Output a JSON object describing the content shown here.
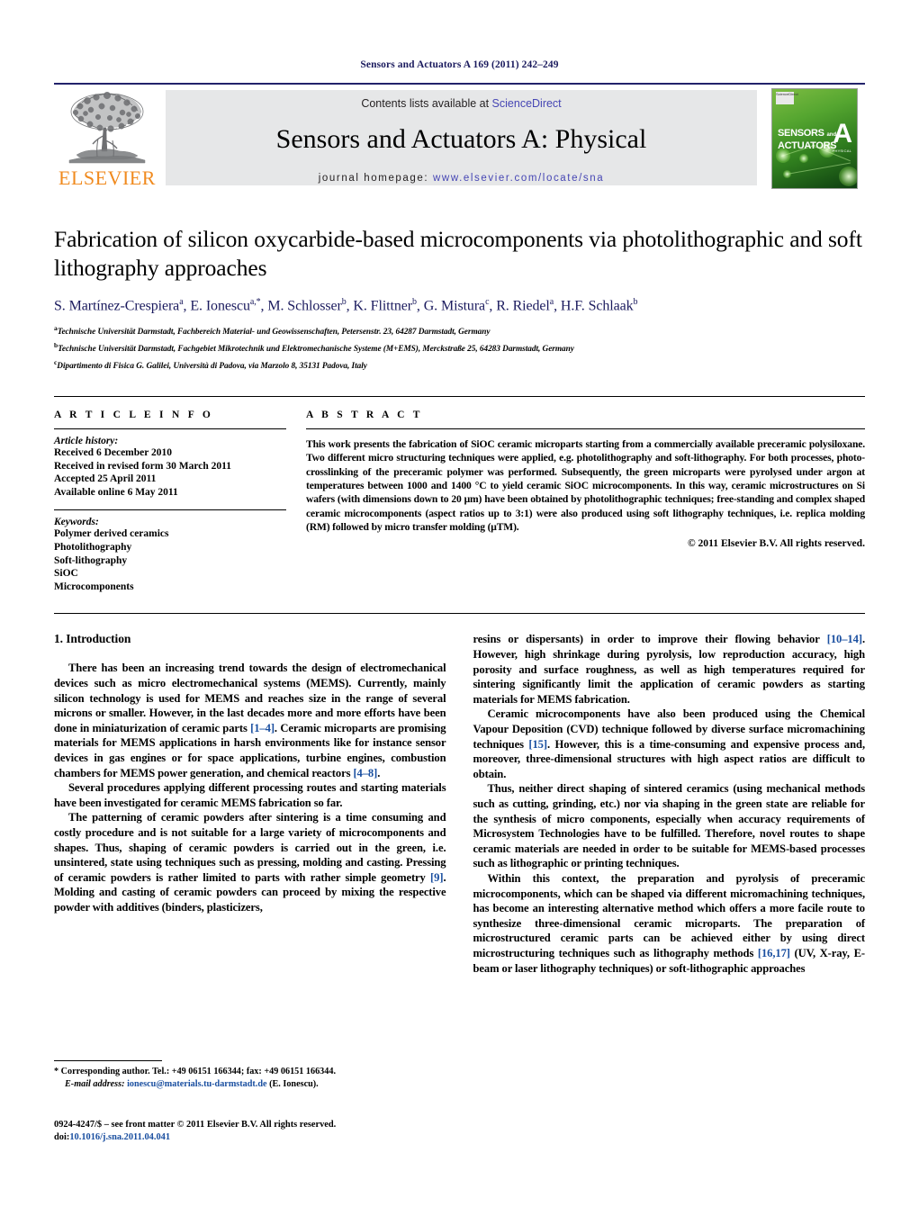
{
  "running_head": "Sensors and Actuators A 169 (2011) 242–249",
  "masthead": {
    "publisher_word": "ELSEVIER",
    "contents_prefix": "Contents lists available at ",
    "contents_link": "ScienceDirect",
    "journal_title": "Sensors and Actuators A: Physical",
    "homepage_label": "journal homepage:",
    "homepage_url": "www.elsevier.com/locate/sna",
    "cover": {
      "line1": "SENSORS",
      "and": "and",
      "line2": "ACTUATORS",
      "letter": "A",
      "sub": "PHYSICAL",
      "badge": "ScienceDirect"
    }
  },
  "article": {
    "title": "Fabrication of silicon oxycarbide-based microcomponents via photolithographic and soft lithography approaches",
    "authors": "S. Martínez-Crespiera a, E. Ionescu a,*, M. Schlosser b, K. Flittner b, G. Mistura c, R. Riedel a, H.F. Schlaak b",
    "author_list": [
      {
        "name": "S. Martínez-Crespiera",
        "sup": "a"
      },
      {
        "name": "E. Ionescu",
        "sup": "a,*"
      },
      {
        "name": "M. Schlosser",
        "sup": "b"
      },
      {
        "name": "K. Flittner",
        "sup": "b"
      },
      {
        "name": "G. Mistura",
        "sup": "c"
      },
      {
        "name": "R. Riedel",
        "sup": "a"
      },
      {
        "name": "H.F. Schlaak",
        "sup": "b"
      }
    ],
    "affiliations": [
      {
        "sup": "a",
        "text": "Technische Universität Darmstadt, Fachbereich Material- und Geowissenschaften, Petersenstr. 23, 64287 Darmstadt, Germany"
      },
      {
        "sup": "b",
        "text": "Technische Universität Darmstadt, Fachgebiet Mikrotechnik und Elektromechanische Systeme (M+EMS), Merckstraße 25, 64283 Darmstadt, Germany"
      },
      {
        "sup": "c",
        "text": "Dipartimento di Fisica G. Galilei, Università di Padova, via Marzolo 8, 35131 Padova, Italy"
      }
    ]
  },
  "article_info": {
    "heading": "A R T I C L E   I N F O",
    "history_label": "Article history:",
    "history": [
      "Received 6 December 2010",
      "Received in revised form 30 March 2011",
      "Accepted 25 April 2011",
      "Available online 6 May 2011"
    ],
    "keywords_label": "Keywords:",
    "keywords": [
      "Polymer derived ceramics",
      "Photolithography",
      "Soft-lithography",
      "SiOC",
      "Microcomponents"
    ]
  },
  "abstract": {
    "heading": "A B S T R A C T",
    "text": "This work presents the fabrication of SiOC ceramic microparts starting from a commercially available preceramic polysiloxane. Two different micro structuring techniques were applied, e.g. photolithography and soft-lithography. For both processes, photo-crosslinking of the preceramic polymer was performed. Subsequently, the green microparts were pyrolysed under argon at temperatures between 1000 and 1400 °C to yield ceramic SiOC microcomponents. In this way, ceramic microstructures on Si wafers (with dimensions down to 20 μm) have been obtained by photolithographic techniques; free-standing and complex shaped ceramic microcomponents (aspect ratios up to 3:1) were also produced using soft lithography techniques, i.e. replica molding (RM) followed by micro transfer molding (μTM).",
    "copyright": "© 2011 Elsevier B.V. All rights reserved."
  },
  "introduction": {
    "heading": "1. Introduction",
    "left_paragraphs": [
      "There has been an increasing trend towards the design of electromechanical devices such as micro electromechanical systems (MEMS). Currently, mainly silicon technology is used for MEMS and reaches size in the range of several microns or smaller. However, in the last decades more and more efforts have been done in miniaturization of ceramic parts [1–4]. Ceramic microparts are promising materials for MEMS applications in harsh environments like for instance sensor devices in gas engines or for space applications, turbine engines, combustion chambers for MEMS power generation, and chemical reactors [4–8].",
      "Several procedures applying different processing routes and starting materials have been investigated for ceramic MEMS fabrication so far.",
      "The patterning of ceramic powders after sintering is a time consuming and costly procedure and is not suitable for a large variety of microcomponents and shapes. Thus, shaping of ceramic powders is carried out in the green, i.e. unsintered, state using techniques such as pressing, molding and casting. Pressing of ceramic powders is rather limited to parts with rather simple geometry [9]. Molding and casting of ceramic powders can proceed by mixing the respective powder with additives (binders, plasticizers,"
    ],
    "right_paragraphs": [
      "resins or dispersants) in order to improve their flowing behavior [10–14]. However, high shrinkage during pyrolysis, low reproduction accuracy, high porosity and surface roughness, as well as high temperatures required for sintering significantly limit the application of ceramic powders as starting materials for MEMS fabrication.",
      "Ceramic microcomponents have also been produced using the Chemical Vapour Deposition (CVD) technique followed by diverse surface micromachining techniques [15]. However, this is a time-consuming and expensive process and, moreover, three-dimensional structures with high aspect ratios are difficult to obtain.",
      "Thus, neither direct shaping of sintered ceramics (using mechanical methods such as cutting, grinding, etc.) nor via shaping in the green state are reliable for the synthesis of micro components, especially when accuracy requirements of Microsystem Technologies have to be fulfilled. Therefore, novel routes to shape ceramic materials are needed in order to be suitable for MEMS-based processes such as lithographic or printing techniques.",
      "Within this context, the preparation and pyrolysis of preceramic microcomponents, which can be shaped via different micromachining techniques, has become an interesting alternative method which offers a more facile route to synthesize three-dimensional ceramic microparts. The preparation of microstructured ceramic parts can be achieved either by using direct microstructuring techniques such as lithography methods [16,17] (UV, X-ray, E-beam or laser lithography techniques) or soft-lithographic approaches"
    ]
  },
  "footnote": {
    "marker": "*",
    "corresponding": "Corresponding author. Tel.: +49 06151 166344; fax: +49 06151 166344.",
    "email_label": "E-mail address:",
    "email": "ionescu@materials.tu-darmstadt.de",
    "email_owner": "(E. Ionescu)."
  },
  "imprint": {
    "issn_line": "0924-4247/$ – see front matter © 2011 Elsevier B.V. All rights reserved.",
    "doi_label": "doi:",
    "doi": "10.1016/j.sna.2011.04.041"
  },
  "colors": {
    "header_blue": "#1b1b5e",
    "link_blue": "#1a4fa0",
    "sciencedirect": "#4646b4",
    "elsevier_orange": "#f08a1e",
    "band_gray": "#e6e7e8"
  }
}
